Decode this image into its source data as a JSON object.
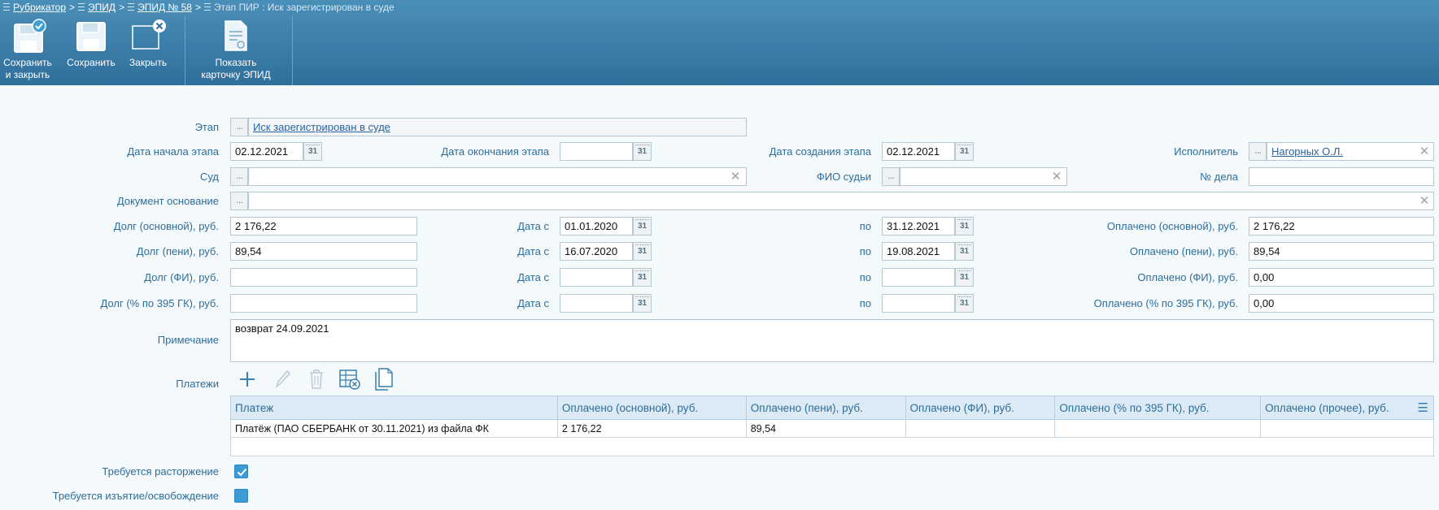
{
  "breadcrumb": {
    "items": [
      "Рубрикатор",
      "ЭПИД",
      "ЭПИД № 58"
    ],
    "separator": ">",
    "current": "Этап ПИР : Иск зарегистрирован в суде"
  },
  "toolbar": {
    "save_close_line1": "Сохранить",
    "save_close_line2": "и закрыть",
    "save": "Сохранить",
    "close": "Закрыть",
    "show_card_line1": "Показать",
    "show_card_line2": "карточку ЭПИД"
  },
  "icons": {
    "dots": "...",
    "calendar": "31",
    "clear": "✕"
  },
  "form": {
    "stage": {
      "label": "Этап",
      "value": "Иск зарегистрирован в суде"
    },
    "stage_start": {
      "label": "Дата начала этапа",
      "value": "02.12.2021"
    },
    "stage_end": {
      "label": "Дата окончания этапа",
      "value": ""
    },
    "stage_created": {
      "label": "Дата создания этапа",
      "value": "02.12.2021"
    },
    "executor": {
      "label": "Исполнитель",
      "value": "Нагорных О.Л."
    },
    "court": {
      "label": "Суд",
      "value": ""
    },
    "judge": {
      "label": "ФИО судьи",
      "value": ""
    },
    "case_number": {
      "label": "№ дела",
      "value": ""
    },
    "base_document": {
      "label": "Документ основание",
      "value": ""
    },
    "date_from_label": "Дата с",
    "date_to_label": "по",
    "rows": [
      {
        "debt_label": "Долг (основной), руб.",
        "debt": "2 176,22",
        "from": "01.01.2020",
        "to": "31.12.2021",
        "paid_label": "Оплачено (основной), руб.",
        "paid": "2 176,22"
      },
      {
        "debt_label": "Долг (пени), руб.",
        "debt": "89,54",
        "from": "16.07.2020",
        "to": "19.08.2021",
        "paid_label": "Оплачено (пени), руб.",
        "paid": "89,54"
      },
      {
        "debt_label": "Долг (ФИ), руб.",
        "debt": "",
        "from": "",
        "to": "",
        "paid_label": "Оплачено (ФИ), руб.",
        "paid": "0,00"
      },
      {
        "debt_label": "Долг (% по 395 ГК), руб.",
        "debt": "",
        "from": "",
        "to": "",
        "paid_label": "Оплачено (% по 395 ГК), руб.",
        "paid": "0,00"
      }
    ],
    "note": {
      "label": "Примечание",
      "value": "возврат 24.09.2021"
    },
    "payments_label": "Платежи",
    "termination": {
      "label": "Требуется расторжение",
      "checked": true
    },
    "seizure": {
      "label": "Требуется изъятие/освобождение",
      "checked": false
    }
  },
  "payments_table": {
    "columns": [
      "Платеж",
      "Оплачено (основной), руб.",
      "Оплачено (пени), руб.",
      "Оплачено (ФИ), руб.",
      "Оплачено (% по 395 ГК), руб.",
      "Оплачено (прочее), руб."
    ],
    "rows": [
      [
        "Платёж (ПАО СБЕРБАНК от 30.11.2021) из файла ФК",
        "2 176,22",
        "89,54",
        "",
        "",
        ""
      ]
    ]
  },
  "colors": {
    "header_top": "#4a8fb9",
    "header_bottom": "#2f6f9b",
    "label": "#2e6d99",
    "link": "#2a63a0",
    "checkbox": "#3b9bd6",
    "background": "#f4f9fc"
  }
}
